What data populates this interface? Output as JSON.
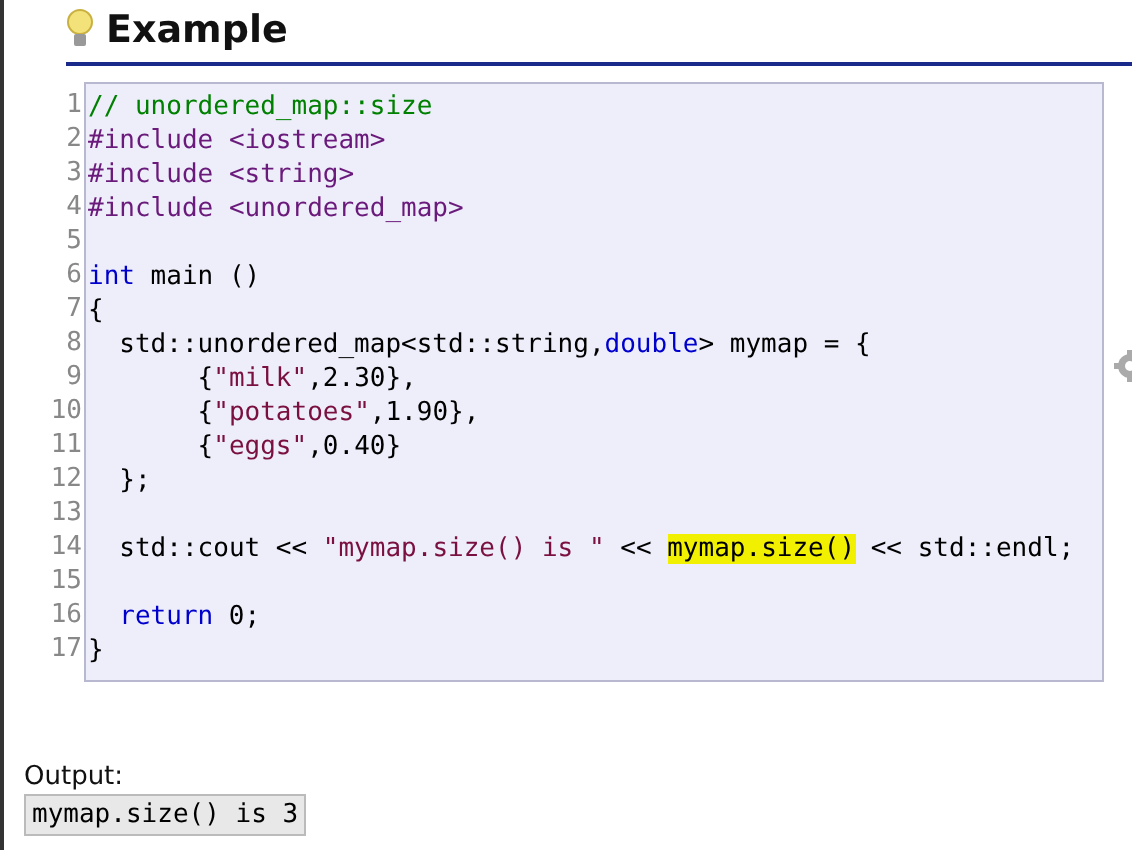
{
  "section": {
    "title": "Example"
  },
  "code": {
    "lines": [
      {
        "number": "1",
        "tokens": [
          {
            "kind": "comment",
            "text": "// unordered_map::size"
          }
        ]
      },
      {
        "number": "2",
        "tokens": [
          {
            "kind": "preproc",
            "text": "#include <iostream>"
          }
        ]
      },
      {
        "number": "3",
        "tokens": [
          {
            "kind": "preproc",
            "text": "#include <string>"
          }
        ]
      },
      {
        "number": "4",
        "tokens": [
          {
            "kind": "preproc",
            "text": "#include <unordered_map>"
          }
        ]
      },
      {
        "number": "5"
      },
      {
        "number": "6",
        "tokens": [
          {
            "kind": "keyword",
            "text": "int"
          },
          {
            "kind": "plain",
            "text": " main ()"
          }
        ]
      },
      {
        "number": "7",
        "tokens": [
          {
            "kind": "plain",
            "text": "{"
          }
        ]
      },
      {
        "number": "8",
        "tokens": [
          {
            "kind": "plain",
            "text": "  std::unordered_map<std::string,"
          },
          {
            "kind": "keyword",
            "text": "double"
          },
          {
            "kind": "plain",
            "text": "> mymap = {"
          }
        ]
      },
      {
        "number": "9",
        "tokens": [
          {
            "kind": "plain",
            "text": "       {"
          },
          {
            "kind": "string",
            "text": "\"milk\""
          },
          {
            "kind": "plain",
            "text": ",2.30},"
          }
        ]
      },
      {
        "number": "10",
        "tokens": [
          {
            "kind": "plain",
            "text": "       {"
          },
          {
            "kind": "string",
            "text": "\"potatoes\""
          },
          {
            "kind": "plain",
            "text": ",1.90},"
          }
        ]
      },
      {
        "number": "11",
        "tokens": [
          {
            "kind": "plain",
            "text": "       {"
          },
          {
            "kind": "string",
            "text": "\"eggs\""
          },
          {
            "kind": "plain",
            "text": ",0.40}"
          }
        ]
      },
      {
        "number": "12",
        "tokens": [
          {
            "kind": "plain",
            "text": "  };"
          }
        ]
      },
      {
        "number": "13"
      },
      {
        "number": "14",
        "tokens": [
          {
            "kind": "plain",
            "text": "  std::cout << "
          },
          {
            "kind": "string",
            "text": "\"mymap.size() is \""
          },
          {
            "kind": "plain",
            "text": " << "
          },
          {
            "kind": "highlight",
            "text": "mymap.size()"
          },
          {
            "kind": "plain",
            "text": " << std::endl;"
          }
        ]
      },
      {
        "number": "15"
      },
      {
        "number": "16",
        "indented": true,
        "tokens": [
          {
            "kind": "keyword",
            "text": "return"
          },
          {
            "kind": "plain",
            "text": " 0;"
          }
        ]
      },
      {
        "number": "17",
        "tokens": [
          {
            "kind": "plain",
            "text": "}"
          }
        ]
      }
    ]
  },
  "output": {
    "label": "Output:",
    "text": "mymap.size() is 3"
  }
}
